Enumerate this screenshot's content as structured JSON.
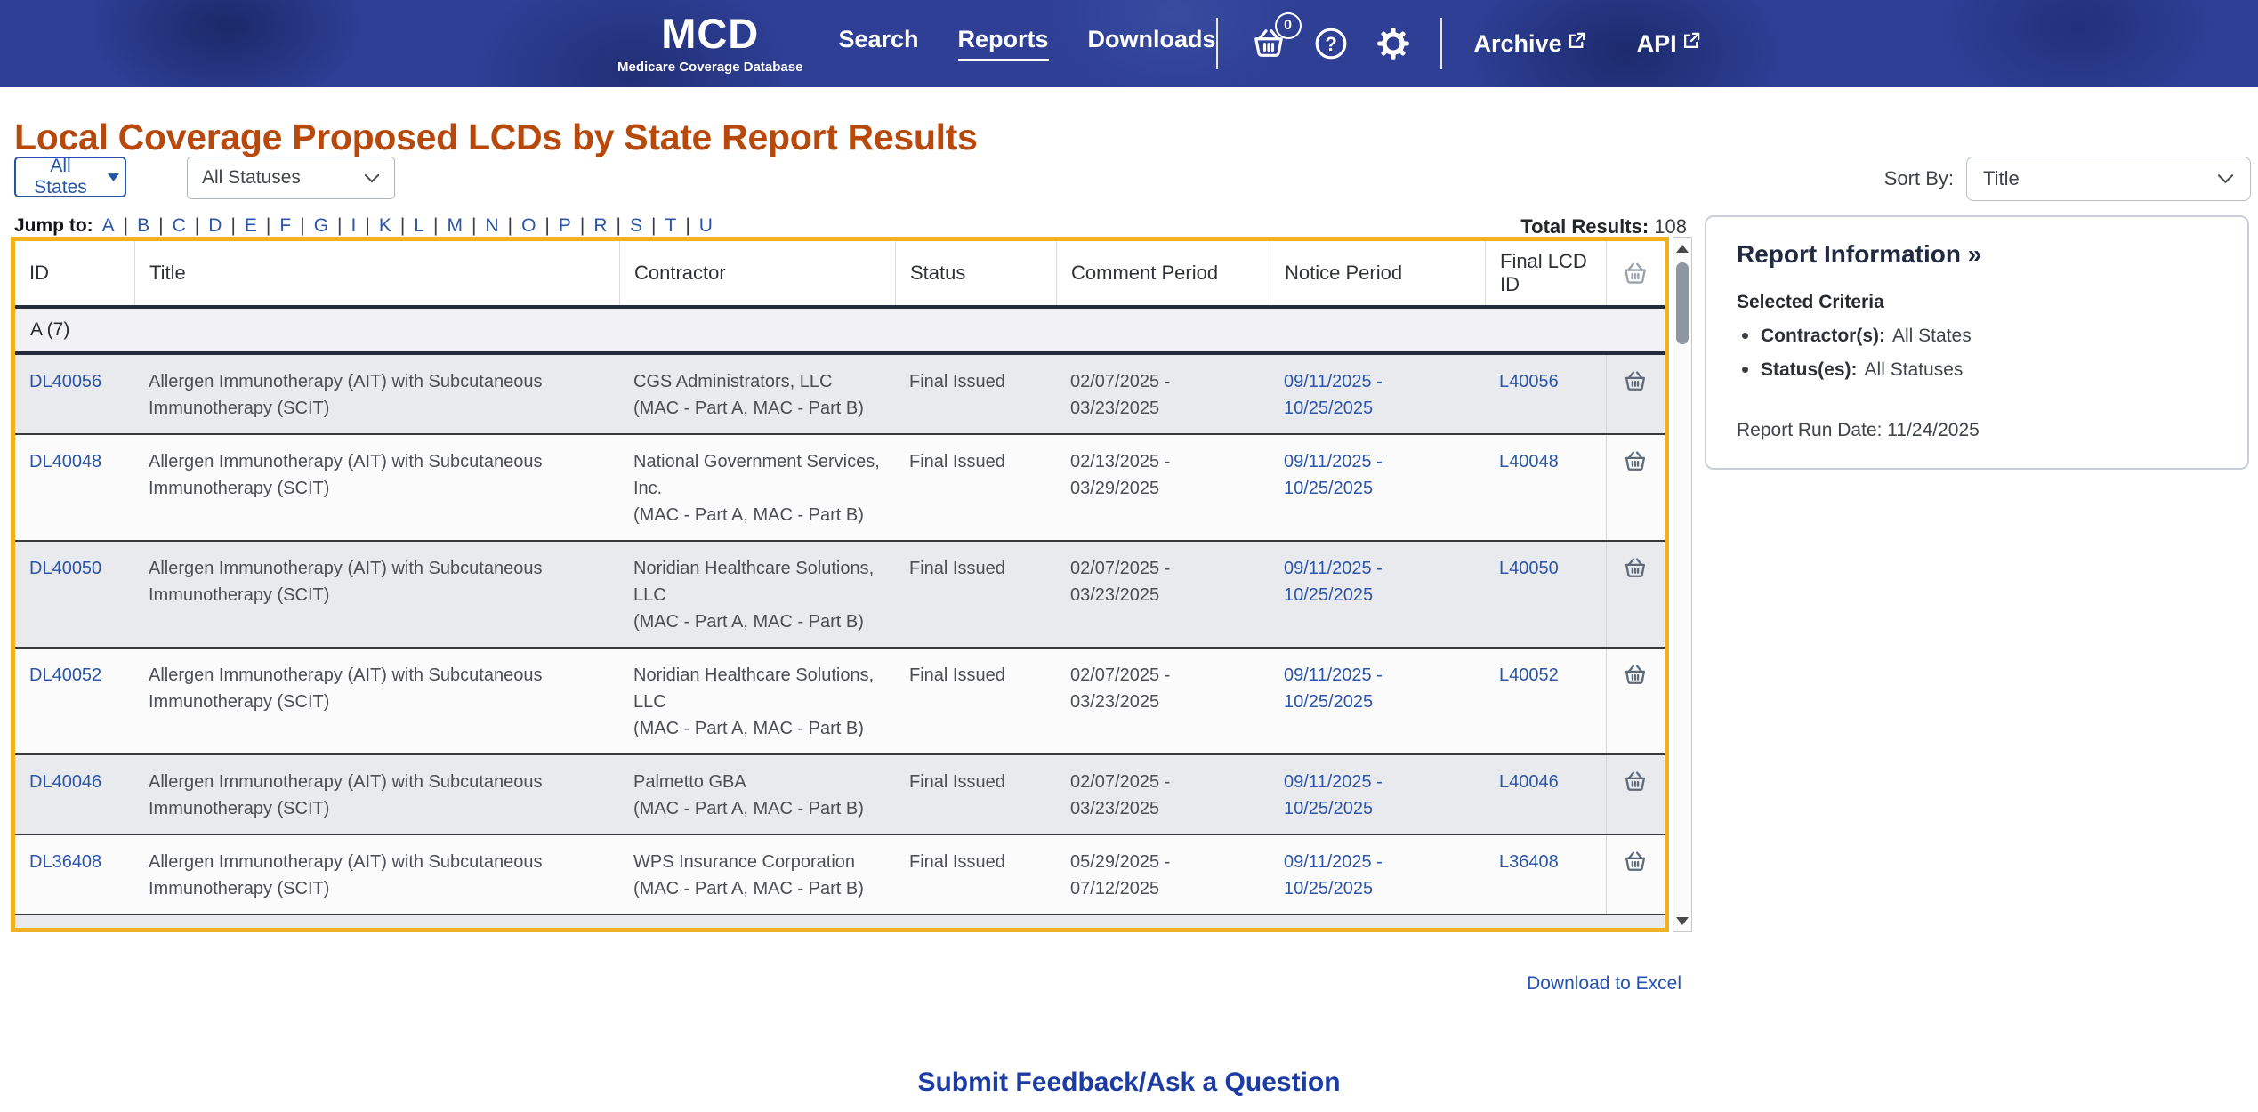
{
  "colors": {
    "header_navy": "#2E3F95",
    "title_orange": "#B7490D",
    "link_blue": "#2B55A8",
    "table_border_gold": "#F1B31D",
    "row_gray": "#E9EAED",
    "row_white": "#FBFBFC"
  },
  "header": {
    "logo_title": "MCD",
    "logo_subtitle": "Medicare Coverage Database",
    "nav": [
      {
        "label": "Search",
        "active": false
      },
      {
        "label": "Reports",
        "active": true
      },
      {
        "label": "Downloads",
        "active": false
      }
    ],
    "cart_count": "0",
    "external_links": [
      {
        "label": "Archive"
      },
      {
        "label": "API"
      }
    ]
  },
  "icons": {
    "cart": "basket-icon",
    "help": "question-circle-icon",
    "settings": "gear-icon",
    "external": "external-link-icon",
    "row_action": "basket-icon",
    "scrollbar": "up-down-arrows"
  },
  "page": {
    "title": "Local Coverage Proposed LCDs by State Report Results",
    "states_filter": "All States",
    "statuses_filter": "All Statuses",
    "sort_by_label": "Sort By:",
    "sort_by_value": "Title",
    "jump_label": "Jump to:",
    "jump_letters": [
      "A",
      "B",
      "C",
      "D",
      "E",
      "F",
      "G",
      "I",
      "K",
      "L",
      "M",
      "N",
      "O",
      "P",
      "R",
      "S",
      "T",
      "U"
    ],
    "total_results_label": "Total Results:",
    "total_results_value": "108",
    "download_link": "Download to Excel",
    "feedback_link": "Submit Feedback/Ask a Question"
  },
  "table": {
    "columns": [
      "ID",
      "Title",
      "Contractor",
      "Status",
      "Comment Period",
      "Notice Period",
      "Final LCD ID"
    ],
    "section_label": "A (7)",
    "rows": [
      {
        "id": "DL40056",
        "title": "Allergen Immunotherapy (AIT) with Subcutaneous Immunotherapy (SCIT)",
        "contractor": "CGS Administrators, LLC",
        "contractor_type": "(MAC - Part A, MAC - Part B)",
        "status": "Final Issued",
        "comment_period": "02/07/2025 - 03/23/2025",
        "notice_period": "09/11/2025 - 10/25/2025",
        "final_lcd_id": "L40056"
      },
      {
        "id": "DL40048",
        "title": "Allergen Immunotherapy (AIT) with Subcutaneous Immunotherapy (SCIT)",
        "contractor": "National Government Services, Inc.",
        "contractor_type": "(MAC - Part A, MAC - Part B)",
        "status": "Final Issued",
        "comment_period": "02/13/2025 - 03/29/2025",
        "notice_period": "09/11/2025 - 10/25/2025",
        "final_lcd_id": "L40048"
      },
      {
        "id": "DL40050",
        "title": "Allergen Immunotherapy (AIT) with Subcutaneous Immunotherapy (SCIT)",
        "contractor": "Noridian Healthcare Solutions, LLC",
        "contractor_type": "(MAC - Part A, MAC - Part B)",
        "status": "Final Issued",
        "comment_period": "02/07/2025 - 03/23/2025",
        "notice_period": "09/11/2025 - 10/25/2025",
        "final_lcd_id": "L40050"
      },
      {
        "id": "DL40052",
        "title": "Allergen Immunotherapy (AIT) with Subcutaneous Immunotherapy (SCIT)",
        "contractor": "Noridian Healthcare Solutions, LLC",
        "contractor_type": "(MAC - Part A, MAC - Part B)",
        "status": "Final Issued",
        "comment_period": "02/07/2025 - 03/23/2025",
        "notice_period": "09/11/2025 - 10/25/2025",
        "final_lcd_id": "L40052"
      },
      {
        "id": "DL40046",
        "title": "Allergen Immunotherapy (AIT) with Subcutaneous Immunotherapy (SCIT)",
        "contractor": "Palmetto GBA",
        "contractor_type": "(MAC - Part A, MAC - Part B)",
        "status": "Final Issued",
        "comment_period": "02/07/2025 - 03/23/2025",
        "notice_period": "09/11/2025 - 10/25/2025",
        "final_lcd_id": "L40046"
      },
      {
        "id": "DL36408",
        "title": "Allergen Immunotherapy (AIT) with Subcutaneous Immunotherapy (SCIT)",
        "contractor": "WPS Insurance Corporation",
        "contractor_type": "(MAC - Part A, MAC - Part B)",
        "status": "Final Issued",
        "comment_period": "05/29/2025 - 07/12/2025",
        "notice_period": "09/11/2025 - 10/25/2025",
        "final_lcd_id": "L36408"
      }
    ]
  },
  "report_info": {
    "title": "Report Information »",
    "criteria_heading": "Selected Criteria",
    "criteria": [
      {
        "label": "Contractor(s):",
        "value": "All States"
      },
      {
        "label": "Status(es):",
        "value": "All Statuses"
      }
    ],
    "run_date_label": "Report Run Date:",
    "run_date_value": "11/24/2025"
  }
}
